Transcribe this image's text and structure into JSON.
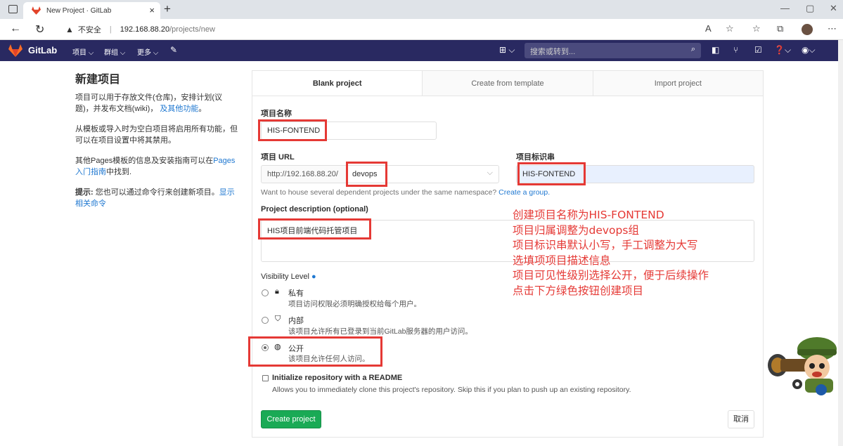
{
  "browser": {
    "tab_title": "New Project · GitLab",
    "tab_close": "×",
    "new_tab": "+",
    "security": "不安全",
    "url_host": "192.168.88.20",
    "url_path": "/projects/new",
    "win_min": "—",
    "win_max": "▢",
    "win_close": "✕"
  },
  "gitlab_header": {
    "brand": "GitLab",
    "nav": [
      {
        "label": "项目 ⌵"
      },
      {
        "label": "群组 ⌵"
      },
      {
        "label": "更多 ⌵"
      }
    ],
    "search_placeholder": "搜索或转到..."
  },
  "sidebar": {
    "title": "新建项目",
    "p1": "项目可以用于存放文件(仓库)，安排计划(议题)，并发布文档(wiki)，",
    "p1_link": "及其他功能",
    "p1_end": "。",
    "p2": "从模板或导入时为空白项目将启用所有功能，但可以在项目设置中将其禁用。",
    "p3_start": "其他Pages模板的信息及安装指南可以在",
    "p3_link": "Pages入门指南",
    "p3_end": "中找到.",
    "tip_label": "提示:",
    "tip_text": " 您也可以通过命令行来创建新项目。",
    "tip_link": "显示相关命令"
  },
  "tabs": [
    {
      "label": "Blank project"
    },
    {
      "label": "Create from template"
    },
    {
      "label": "Import project"
    }
  ],
  "form": {
    "name_label": "项目名称",
    "name_value": "HIS-FONTEND",
    "url_label": "项目 URL",
    "url_prefix": "http://192.168.88.20/",
    "namespace": "devops",
    "slug_label": "项目标识串",
    "slug_value": "HIS-FONTEND",
    "namespace_help": "Want to house several dependent projects under the same namespace?",
    "namespace_help_link": "Create a group.",
    "desc_label": "Project description (optional)",
    "desc_value": "HIS项目前端代码托管项目",
    "visibility_label": "Visibility Level",
    "visibility": [
      {
        "title": "私有",
        "desc": "项目访问权限必须明确授权给每个用户。",
        "checked": false
      },
      {
        "title": "内部",
        "desc": "该项目允许所有已登录到当前GitLab服务器的用户访问。",
        "checked": false
      },
      {
        "title": "公开",
        "desc": "该项目允许任何人访问。",
        "checked": true
      }
    ],
    "readme_label": "Initialize repository with a README",
    "readme_desc": "Allows you to immediately clone this project's repository. Skip this if you plan to push up an existing repository.",
    "create_button": "Create project",
    "cancel_button": "取消"
  },
  "annotation": {
    "lines": [
      "创建项目名称为HIS-FONTEND",
      "项目归属调整为devops组",
      "项目标识串默认小写，手工调整为大写",
      "选填项项目描述信息",
      "项目可见性级别选择公开，便于后续操作",
      "点击下方绿色按钮创建项目"
    ]
  },
  "colors": {
    "gitlab_header": "#292961",
    "accent_link": "#1f78d1",
    "create_button": "#1aaa55",
    "annotation_red": "#e53935"
  }
}
